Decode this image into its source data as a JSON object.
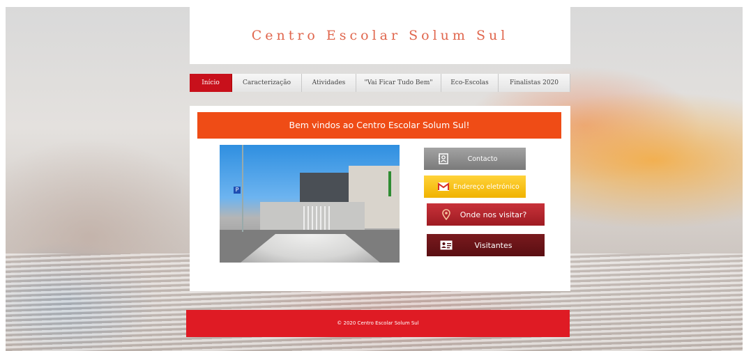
{
  "header": {
    "title": "Centro Escolar Solum Sul"
  },
  "nav": {
    "items": [
      {
        "label": "Início",
        "active": true
      },
      {
        "label": "Caracterização"
      },
      {
        "label": "Atividades"
      },
      {
        "label": "\"Vai Ficar Tudo Bem\""
      },
      {
        "label": "Eco-Escolas"
      },
      {
        "label": "Finalistas 2020"
      }
    ]
  },
  "main": {
    "welcome": "Bem vindos ao Centro Escolar Solum Sul!",
    "photo_sign": "P",
    "buttons": {
      "contacto": "Contacto",
      "email": "Endereço eletrónico",
      "visit": "Onde nos visitar?",
      "visitantes": "Visitantes"
    }
  },
  "footer": {
    "text": "© 2020 Centro Escolar Solum Sul"
  },
  "colors": {
    "title": "#e0664d",
    "nav_active": "#c8101b",
    "welcome_bar": "#ef4c16",
    "footer": "#df1b24",
    "contacto": "#8f8f8f",
    "email": "#f5c21b",
    "visit": "#b0262d",
    "visitantes": "#6a1418"
  },
  "icons": {
    "contacto": "contact-book-icon",
    "email": "gmail-icon",
    "visit": "location-pin-icon",
    "visitantes": "visitor-card-icon"
  }
}
